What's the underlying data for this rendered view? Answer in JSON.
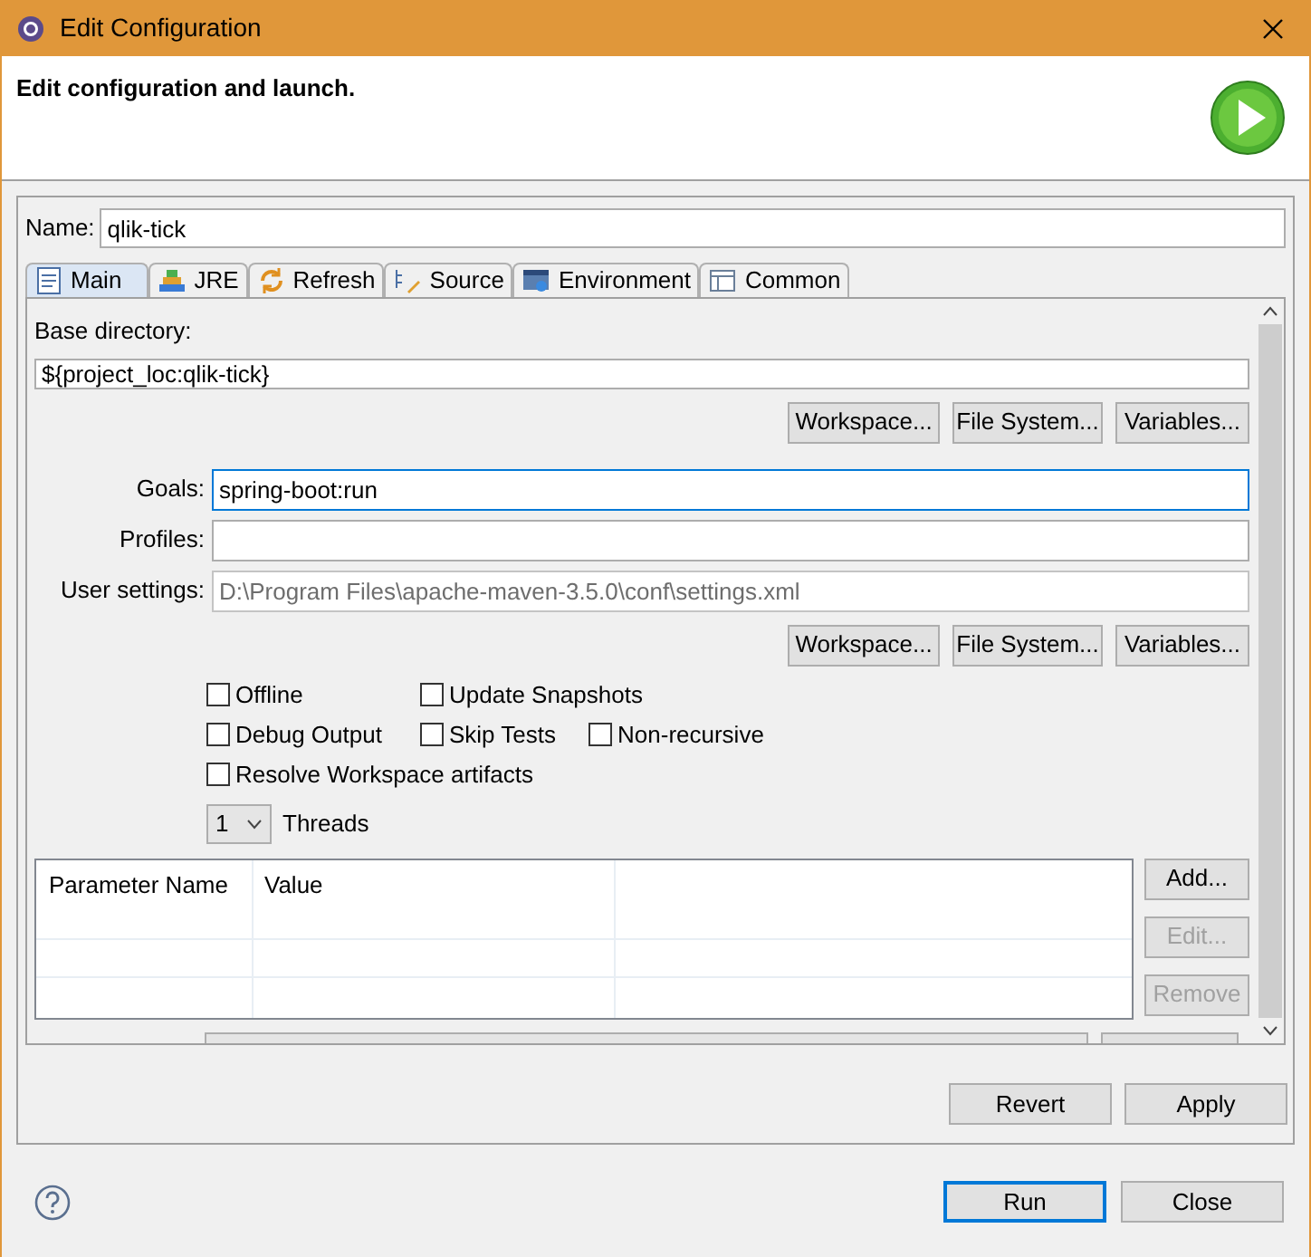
{
  "window": {
    "title": "Edit Configuration"
  },
  "header": {
    "title": "Edit configuration and launch."
  },
  "name_field": {
    "label": "Name:",
    "value": "qlik-tick"
  },
  "tabs": [
    {
      "label": "Main",
      "kind": "main",
      "selected": true
    },
    {
      "label": "JRE",
      "kind": "jre",
      "selected": false
    },
    {
      "label": "Refresh",
      "kind": "refresh",
      "selected": false
    },
    {
      "label": "Source",
      "kind": "source",
      "selected": false
    },
    {
      "label": "Environment",
      "kind": "environment",
      "selected": false
    },
    {
      "label": "Common",
      "kind": "common",
      "selected": false
    }
  ],
  "base_directory": {
    "label": "Base directory:",
    "value": "${project_loc:qlik-tick}",
    "buttons": [
      "Workspace...",
      "File System...",
      "Variables..."
    ]
  },
  "fields": [
    {
      "label": "Goals:",
      "value": "spring-boot:run",
      "focused": true,
      "greyed": false
    },
    {
      "label": "Profiles:",
      "focused": false,
      "greyed": false
    },
    {
      "label": "User settings:",
      "value": "D:\\Program Files\\apache-maven-3.5.0\\conf\\settings.xml",
      "focused": false,
      "greyed": true
    }
  ],
  "settings_buttons": [
    "Workspace...",
    "File System...",
    "Variables..."
  ],
  "checkbox_rows": [
    [
      {
        "label": "Offline",
        "checked": false
      },
      {
        "label": "Update Snapshots",
        "checked": false
      }
    ],
    [
      {
        "label": "Debug Output",
        "checked": false
      },
      {
        "label": "Skip Tests",
        "checked": false
      },
      {
        "label": "Non-recursive",
        "checked": false
      }
    ],
    [
      {
        "label": "Resolve Workspace artifacts",
        "checked": false
      }
    ]
  ],
  "threads": {
    "value": "1",
    "label": "Threads"
  },
  "parameters": {
    "columns": [
      "Parameter Name",
      "Value"
    ],
    "buttons": [
      {
        "label": "Add...",
        "disabled": false
      },
      {
        "label": "Edit...",
        "disabled": true
      },
      {
        "label": "Remove",
        "disabled": true
      }
    ]
  },
  "panel_buttons": [
    "Revert",
    "Apply"
  ],
  "dialog_buttons": [
    {
      "label": "Run",
      "default": true
    },
    {
      "label": "Close",
      "default": false
    }
  ]
}
